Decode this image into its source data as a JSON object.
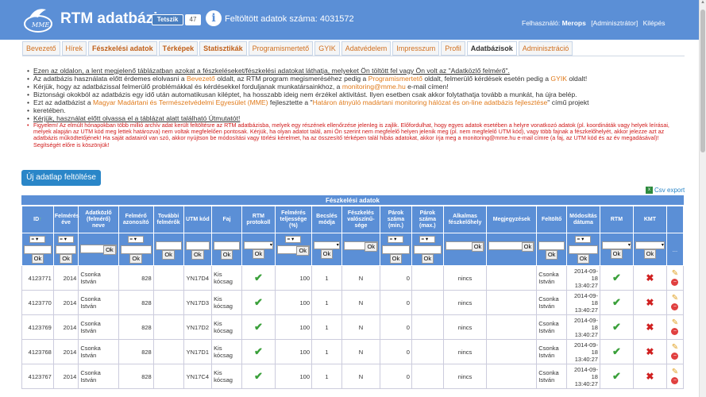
{
  "header": {
    "brand": "RTM adatbázis",
    "logo_text": "MME",
    "tweet": "Tetszik",
    "tweet_count": "47",
    "info_icon": "i",
    "count_text": "Feltöltött adatok száma: 4031572",
    "user_label": "Felhasználó:",
    "user_name": "Merops",
    "role": "[Adminisztrátor]",
    "logout": "Kilépés"
  },
  "nav": {
    "tabs": [
      {
        "label": "Bevezető"
      },
      {
        "label": "Hírek"
      },
      {
        "label": "Fészkelési adatok",
        "bold": true
      },
      {
        "label": "Térképek",
        "bold": true
      },
      {
        "label": "Statisztikák",
        "bold": true
      },
      {
        "label": "Programismertető"
      },
      {
        "label": "GYIK"
      },
      {
        "label": "Adatvédelem"
      },
      {
        "label": "Impresszum"
      },
      {
        "label": "Profil"
      },
      {
        "label": "Adatbázisok",
        "active": true
      },
      {
        "label": "Adminisztráció"
      }
    ]
  },
  "notice": {
    "l1a": "Ezen az oldalon, a lent megjelenő táblázatban azokat a fészkeléseket/fészkelési adatokat láthatja, melyeket Ön töltött fel vagy Ön volt az \"Adatközlő felmérő\".",
    "l2a": "Az adatbázis használata előtt érdemes elolvasni a ",
    "l2b": "Bevezető",
    "l2c": " oldalt, az RTM program megismeréséhez pedig a ",
    "l2d": "Programismertető",
    "l2e": " oldalt, felmerülő kérdések esetén pedig a ",
    "l2f": "GYIK",
    "l2g": " oldalt!",
    "l3a": "Kérjük, hogy az adatbázissal felmerülő problémákkal és kérdésekkel forduljanak munkatársainkhoz, a ",
    "l3b": "monitoring@mme.hu",
    "l3c": " e-mail címen!",
    "l4": "Biztonsági okokból az adatbázis egy idő után automatikusan kiléptet, ha hosszabb ideig nem érzékel aktivitást. Ilyen esetben csak akkor folytathatja tovább a munkát, ha újra belép.",
    "l5a": "Ezt az adatbázist a ",
    "l5b": "Magyar Madártani és Természetvédelmi Egyesület (MME)",
    "l5c": " fejlesztette a \"",
    "l5d": "Határon átnyúló madártani monitoring hálózat és on-line adatbázis fejlesztése",
    "l5e": "\" című projekt",
    "l5f": "keretében.",
    "l6": "Kérjük, használat előtt olvassa el a táblázat alatt található Útmutatót!",
    "red": "Figyelem! Az elmúlt hónapokban több millió archív adat került feltöltésre az RTM adatbázisba, melyek egy részének ellenőrzése jelenleg is zajlik. Előfordulhat, hogy egyes adatok esetében a helyre vonatkozó adatok (pl. koordináták vagy helyek leírásai, melyek alapján az UTM kód meg lettek határozva) nem voltak megfelelően pontosak. Kérjük, ha olyan adatot talál, ami Ön szerint nem megfelelő helyen jelenik meg (pl. nem megfelelő UTM kód), vagy több fajnak a fészkelőhelyét, akkor jelezze azt az adatbázis működtetőjének! Ha saját adatairól van szó, akkor nyújtson be módosítási vagy törlési kérelmet, ha az összesítő térképen talál hibás adatokat, akkor írja meg a monitoring@mme.hu e-mail címre (a faj, az UTM kód és az év megadásával)! Segítségét előre is köszönjük!"
  },
  "buttons": {
    "new": "Új adatlap feltöltése",
    "csv": "Csv export"
  },
  "table": {
    "title": "Fészkelési adatok",
    "headers": [
      "ID",
      "Felmérés éve",
      "Adatközlő (felmérő) neve",
      "Felmérő azonosító",
      "További felmérők",
      "UTM kód",
      "Faj",
      "RTM protokoll",
      "Felmérés teljessége (%)",
      "Becslés módja",
      "Fészkelés valószínű-sége",
      "Párok száma (min.)",
      "Párok száma (max.)",
      "Alkalmas fészkelőhely",
      "Megjegyzések",
      "Feltöltő",
      "Módosítás dátuma",
      "RTM",
      "KMT",
      ""
    ],
    "filter": {
      "op": "=",
      "ok": "Ok",
      "dots": "..."
    },
    "rows": [
      {
        "id": "4123771",
        "year": "2014",
        "name": "Csonka István",
        "obs": "828",
        "utm": "YN17D4",
        "faj": "Kis kócsag",
        "pct": "100",
        "becs": "1",
        "val": "N",
        "parmin": "0",
        "alk": "nincs",
        "feltolto": "Csonka István",
        "date": "2014-09-18 13:40:27"
      },
      {
        "id": "4123770",
        "year": "2014",
        "name": "Csonka István",
        "obs": "828",
        "utm": "YN17D3",
        "faj": "Kis kócsag",
        "pct": "100",
        "becs": "1",
        "val": "N",
        "parmin": "0",
        "alk": "nincs",
        "feltolto": "Csonka István",
        "date": "2014-09-18 13:40:27"
      },
      {
        "id": "4123769",
        "year": "2014",
        "name": "Csonka István",
        "obs": "828",
        "utm": "YN17D2",
        "faj": "Kis kócsag",
        "pct": "100",
        "becs": "1",
        "val": "N",
        "parmin": "0",
        "alk": "nincs",
        "feltolto": "Csonka István",
        "date": "2014-09-18 13:40:27"
      },
      {
        "id": "4123768",
        "year": "2014",
        "name": "Csonka István",
        "obs": "828",
        "utm": "YN17D1",
        "faj": "Kis kócsag",
        "pct": "100",
        "becs": "1",
        "val": "N",
        "parmin": "0",
        "alk": "nincs",
        "feltolto": "Csonka István",
        "date": "2014-09-18 13:40:27"
      },
      {
        "id": "4123767",
        "year": "2014",
        "name": "Csonka István",
        "obs": "828",
        "utm": "YN17C4",
        "faj": "Kis kócsag",
        "pct": "100",
        "becs": "1",
        "val": "N",
        "parmin": "0",
        "alk": "nincs",
        "feltolto": "Csonka István",
        "date": "2014-09-18 13:40:27"
      }
    ]
  }
}
